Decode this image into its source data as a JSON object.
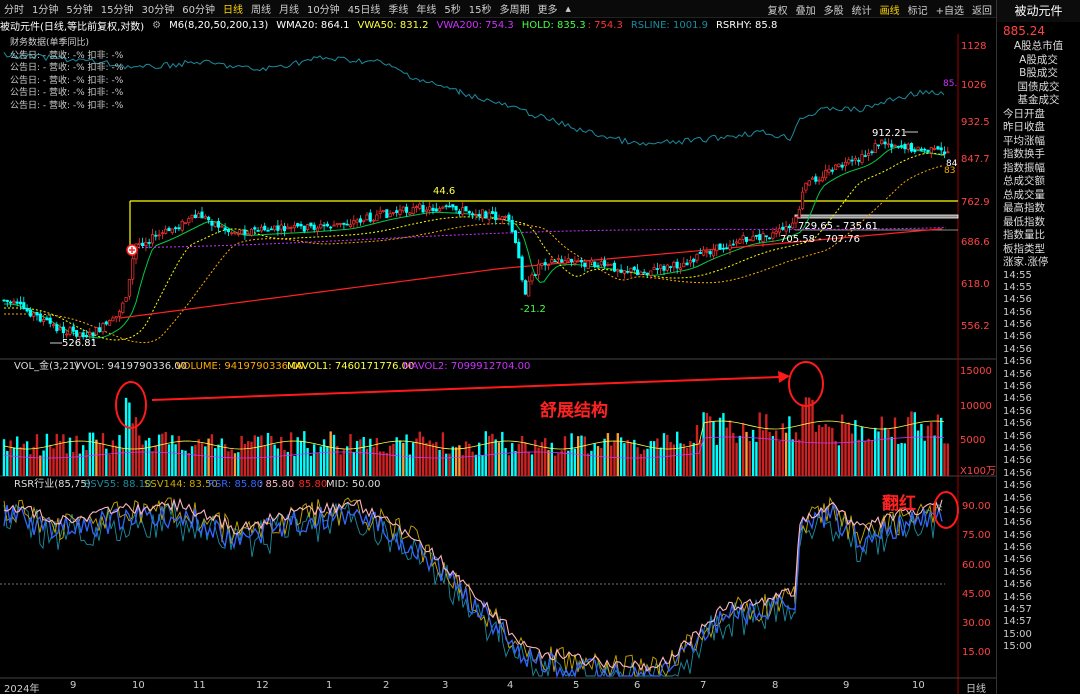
{
  "toolbar": {
    "timeframes": [
      "分时",
      "1分钟",
      "5分钟",
      "15分钟",
      "30分钟",
      "60分钟",
      "日线",
      "周线",
      "月线",
      "10分钟",
      "45日线",
      "季线",
      "年线",
      "5秒",
      "15秒",
      "多周期",
      "更多"
    ],
    "active_timeframe": "日线",
    "tools": [
      "复权",
      "叠加",
      "多股",
      "统计",
      "画线",
      "标记",
      "+自选",
      "返回"
    ],
    "active_tool": "画线",
    "settings_icon": "gear-icon",
    "dropdown_icon": "chevron-up-icon"
  },
  "info_bar": {
    "title": "被动元件(日线,等比前复权,对数)",
    "ma_label": "M6(8,20,50,200,13)",
    "wma20": "WMA20: 864.1",
    "vwa50": "VWA50: 831.2",
    "vwa200": "VWA200: 754.3",
    "hold_a": "HOLD: 835.3",
    "hold_b": ": 754.3",
    "rsline": "RSLINE: 1001.9",
    "rsrhy": "RSRHY: 85.8"
  },
  "financial": {
    "title": "财务数据(单季同比)",
    "rows": [
      "公告日: - 营收: -% 扣非: -%",
      "公告日: - 营收: -% 扣非: -%",
      "公告日: - 营收: -% 扣非: -%",
      "公告日: - 营收: -% 扣非: -%",
      "公告日: - 营收: -% 扣非: -%"
    ]
  },
  "price_axis": [
    "1128",
    "1026",
    "932.5",
    "847.7",
    "762.9",
    "686.6",
    "618.0",
    "556.2"
  ],
  "price_annotations": {
    "low": "526.81",
    "peak1": "44.6",
    "dip": "-21.2",
    "high": "912.21",
    "range1": "729.65 - 735.61",
    "range2": "705.58 - 707.76",
    "rsline_tag": "85.",
    "right_tag1": "84",
    "right_tag2": "83"
  },
  "volume": {
    "header": "VOL_金(3,21)",
    "vvol": "VVOL: 9419790336.00",
    "volume": "VOLUME: 9419790336.00",
    "mavol1": "MAVOL1: 7460171776.00",
    "mavol2": "MAVOL2: 7099912704.00",
    "axis": [
      "15000",
      "10000",
      "5000"
    ],
    "unit": "X100万",
    "annotation": "舒展结构"
  },
  "rsr": {
    "header": "RSR行业(85,75)",
    "ssv55": "SSV55: 88.10",
    "ssv144": "SSV144: 83.50",
    "rsr": "RSR: 85.80",
    "v1": ": 85.80",
    "v2": ": 85.80",
    "mid": "MID: 50.00",
    "axis": [
      "90.00",
      "75.00",
      "60.00",
      "45.00",
      "30.00",
      "15.00"
    ],
    "annotation": "翻红"
  },
  "xaxis": [
    "2024年",
    "9",
    "10",
    "11",
    "12",
    "1",
    "2",
    "3",
    "4",
    "5",
    "6",
    "7",
    "8",
    "9",
    "10"
  ],
  "xaxis_right": "日线",
  "right_panel": {
    "title": "被动元件",
    "price": "885.24",
    "items": [
      "A股总市值",
      "A股成交",
      "B股成交",
      "国债成交",
      "基金成交",
      "今日开盘",
      "昨日收盘",
      "平均涨幅",
      "指数换手",
      "指数振幅",
      "总成交额",
      "总成交量",
      "最高指数",
      "最低指数",
      "指数量比",
      "板指类型",
      "涨家.涨停"
    ],
    "times": [
      "14:55",
      "14:55",
      "14:56",
      "14:56",
      "14:56",
      "14:56",
      "14:56",
      "14:56",
      "14:56",
      "14:56",
      "14:56",
      "14:56",
      "14:56",
      "14:56",
      "14:56",
      "14:56",
      "14:56",
      "14:56",
      "14:56",
      "14:56",
      "14:56",
      "14:56",
      "14:56",
      "14:56",
      "14:56",
      "14:56",
      "14:56",
      "14:57",
      "14:57",
      "15:00",
      "15:00"
    ]
  },
  "colors": {
    "up": "#ff3333",
    "down": "#00ffff",
    "ma_yellow": "#ffff00",
    "ma_green": "#00cc44",
    "ma_orange": "#ffaa00",
    "ma_purple": "#cc33ff",
    "ma_red": "#ff2222",
    "rsline": "#1a8ca0",
    "annotation": "#ff2222"
  }
}
